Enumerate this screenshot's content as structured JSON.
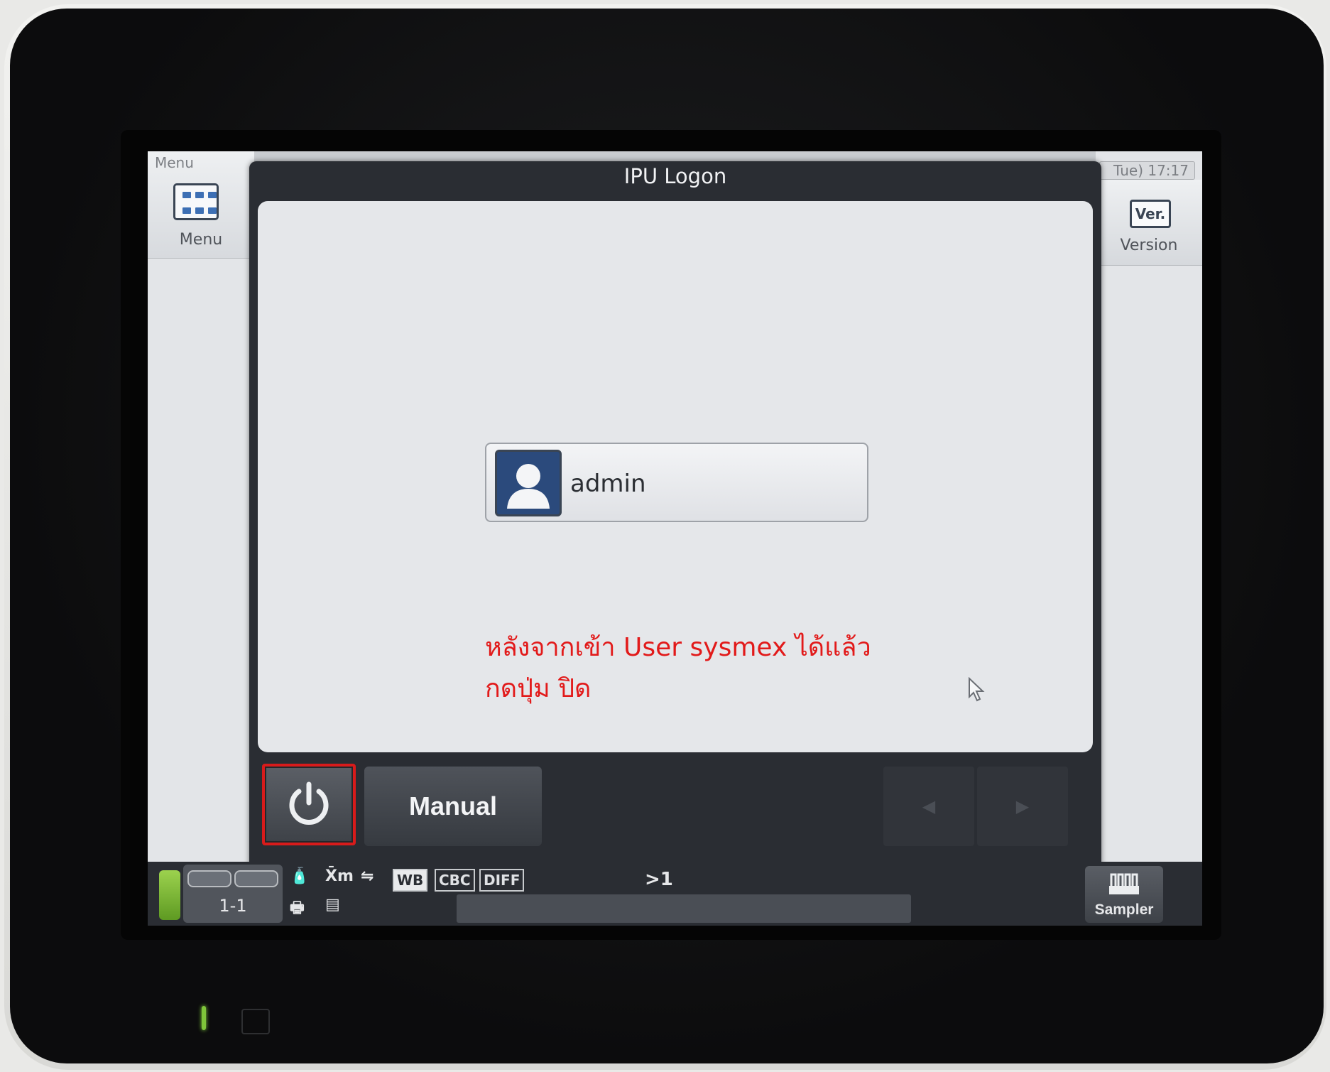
{
  "menu": {
    "caption": "Menu",
    "label": "Menu",
    "icon": "menu-grid-icon"
  },
  "clock": "Tue) 17:17",
  "version": {
    "icon_text": "Ver.",
    "label": "Version"
  },
  "dialog": {
    "title": "IPU Logon"
  },
  "user": {
    "name": "admin",
    "icon": "user-avatar-icon"
  },
  "annotation": {
    "line1": "หลังจากเข้า User sysmex ได้แล้ว",
    "line2": "กดปุ่ม ปิด",
    "color": "#e21a1a"
  },
  "buttons": {
    "power_icon": "power-icon",
    "manual": "Manual",
    "prev": "◀",
    "next": "▶"
  },
  "status": {
    "rack_label": "1-1",
    "x_label": "X̄m",
    "modes": [
      "WB",
      "CBC",
      "DIFF"
    ],
    "active_mode": "WB",
    "count": ">1",
    "sampler": "Sampler"
  },
  "colors": {
    "status_led": "#7fc53a",
    "highlight_border": "#d81b1b"
  }
}
